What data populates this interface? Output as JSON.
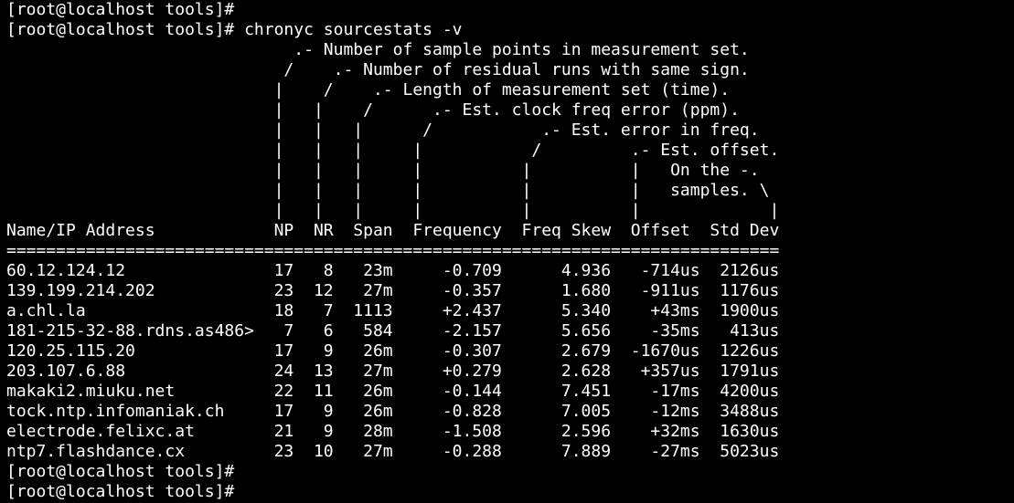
{
  "terminal": {
    "lines": [
      "[root@localhost tools]#",
      "[root@localhost tools]# chronyc sourcestats -v",
      "                             .- Number of sample points in measurement set.",
      "                            /    .- Number of residual runs with same sign.",
      "                           |    /    .- Length of measurement set (time).",
      "                           |   |    /      .- Est. clock freq error (ppm).",
      "                           |   |   |      /           .- Est. error in freq.",
      "                           |   |   |     |           /         .- Est. offset.",
      "                           |   |   |     |          |          |   On the -.",
      "                           |   |   |     |          |          |   samples. \\",
      "                           |   |   |     |          |          |             |",
      "Name/IP Address            NP  NR  Span  Frequency  Freq Skew  Offset  Std Dev",
      "==============================================================================",
      "60.12.124.12               17   8   23m     -0.709      4.936   -714us  2126us",
      "139.199.214.202            23  12   27m     -0.357      1.680   -911us  1176us",
      "a.chl.la                   18   7  1113     +2.437      5.340    +43ms  1900us",
      "181-215-32-88.rdns.as486>   7   6   584     -2.157      5.656    -35ms   413us",
      "120.25.115.20              17   9   26m     -0.307      2.679  -1670us  1226us",
      "203.107.6.88               24  13   27m     +0.279      2.628   +357us  1791us",
      "makaki2.miuku.net          22  11   26m     -0.144      7.451    -17ms  4200us",
      "tock.ntp.infomaniak.ch     17   9   26m     -0.828      7.005    -12ms  3488us",
      "electrode.felixc.at        21   9   28m     -1.508      2.596    +32ms  1630us",
      "ntp7.flashdance.cx         23  10   27m     -0.288      7.889    -27ms  5023us",
      "[root@localhost tools]#",
      "[root@localhost tools]# "
    ]
  },
  "colors": {
    "background": "#000000",
    "foreground": "#ffffff"
  }
}
